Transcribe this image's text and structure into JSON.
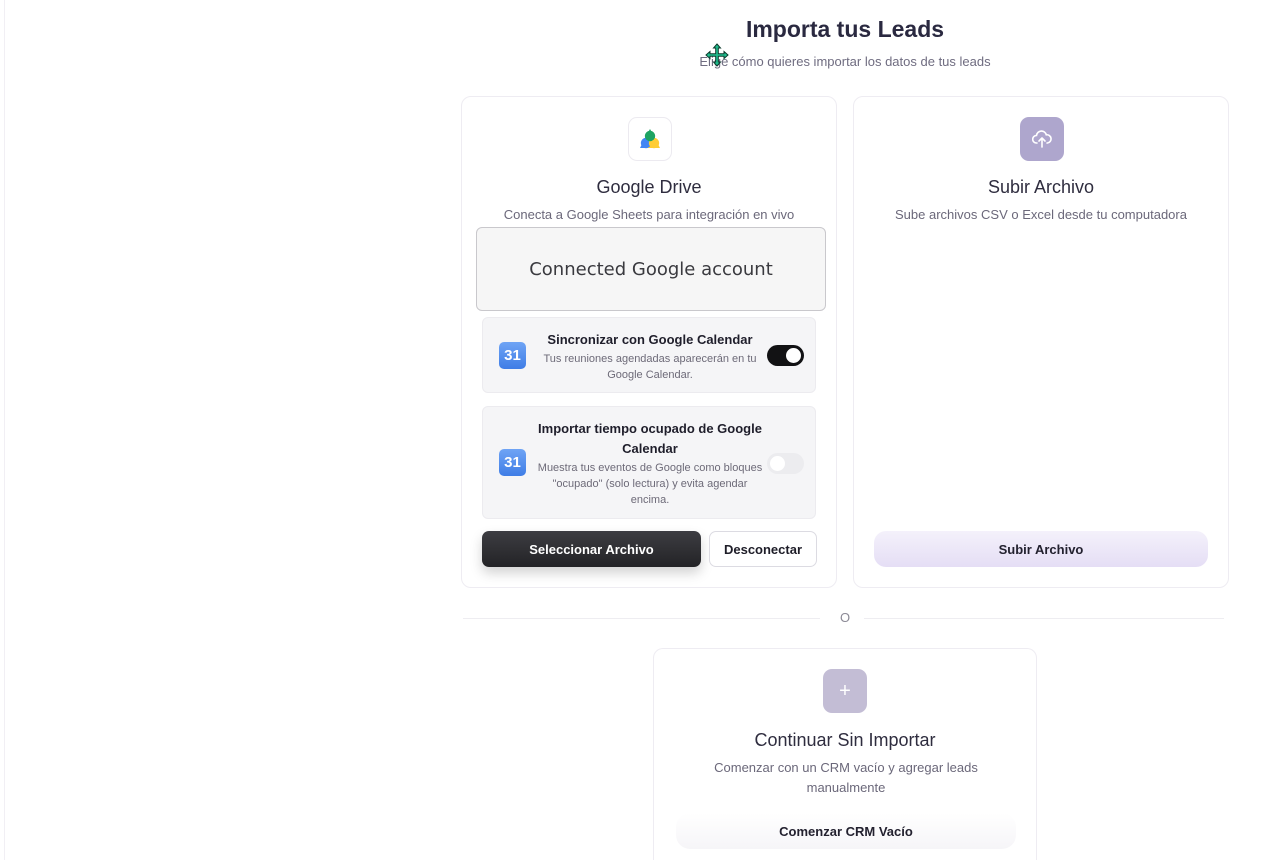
{
  "header": {
    "title": "Importa tus Leads",
    "subtitle": "Elige cómo quieres importar los datos de tus leads"
  },
  "google_card": {
    "icon": "google-drive-icon",
    "title": "Google Drive",
    "description": "Conecta a Google Sheets para integración en vivo",
    "connected_label": "Connected Google account",
    "sync_calendar": {
      "icon_text": "31",
      "title": "Sincronizar con Google Calendar",
      "description": "Tus reuniones agendadas aparecerán en tu Google Calendar.",
      "enabled": true
    },
    "import_busy": {
      "icon_text": "31",
      "title": "Importar tiempo ocupado de Google Calendar",
      "description": "Muestra tus eventos de Google como bloques \"ocupado\" (solo lectura) y evita agendar encima.",
      "enabled": false
    },
    "select_button": "Seleccionar Archivo",
    "disconnect_button": "Desconectar"
  },
  "upload_card": {
    "icon": "upload-cloud-icon",
    "title": "Subir Archivo",
    "description": "Sube archivos CSV o Excel desde tu computadora",
    "button": "Subir Archivo"
  },
  "divider": {
    "text": "O"
  },
  "empty_card": {
    "icon": "plus-icon",
    "icon_glyph": "+",
    "title": "Continuar Sin Importar",
    "description": "Comenzar con un CRM vacío y agregar leads manualmente",
    "button": "Comenzar CRM Vacío"
  },
  "colors": {
    "accent_upload": "#aea6cd",
    "accent_plus": "#c3bdd5",
    "toggle_on": "#121214",
    "primary_button": "#2a2a2e",
    "calendar_blue": "#4a86ea"
  }
}
